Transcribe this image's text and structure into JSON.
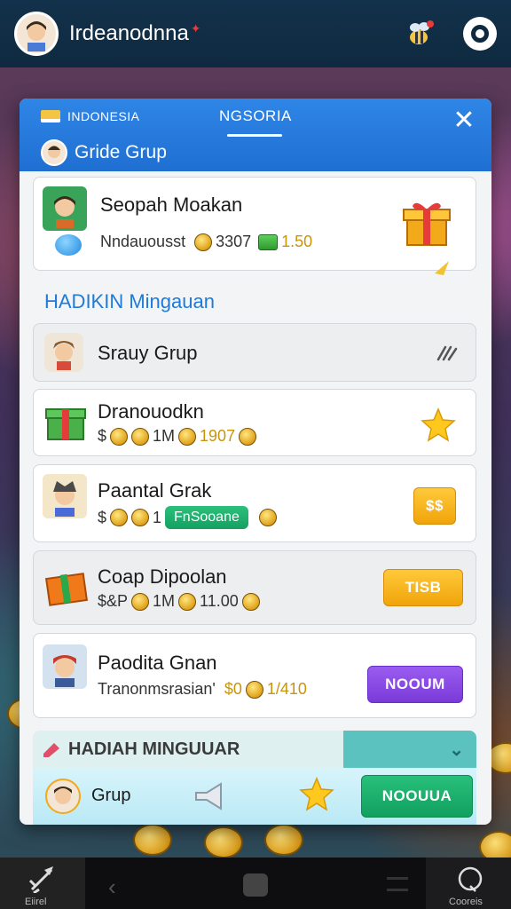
{
  "header": {
    "title": "Irdeanodnna",
    "avatar_icon": "avatar-icon",
    "bee_icon": "bee-icon",
    "settings_icon": "settings-icon"
  },
  "modal": {
    "region_label": "INDONESIA",
    "tab_label": "NGSORIA",
    "close_label": "✕",
    "group_title": "Gride Grup"
  },
  "top_card": {
    "name": "Seopah Moakan",
    "sub_label": "Nndauousst",
    "value_a": "3307",
    "value_b": "1.50"
  },
  "section_title": "HADIKIN Mingauan",
  "rows": [
    {
      "name": "Srauy Grup"
    },
    {
      "name": "Dranouodkn",
      "sub_a": "$",
      "sub_b": "1M",
      "sub_c": "1907"
    },
    {
      "name": "Paantal Grak",
      "sub_a": "$",
      "sub_b": "1",
      "pill": "FnSooane",
      "button": "$$"
    },
    {
      "name": "Coap Dipoolan",
      "sub_a": "$&P",
      "sub_b": "1M",
      "sub_c": "11.00",
      "button": "TISB"
    },
    {
      "name": "Paodita Gnan",
      "sub_label": "Tranonmsrasian'",
      "sub_a": "$0",
      "sub_c": "1/410",
      "button": "NOOUM"
    }
  ],
  "footer": {
    "title": "HADIAH MINGUUAR",
    "row_label": "Grup",
    "button": "NOOUUA"
  },
  "navbar": {
    "left_label": "Eiirel",
    "right_label": "Cooreis"
  },
  "colors": {
    "header_bg": "#12314a",
    "modal_head": "#2f86e6",
    "accent_blue": "#1f7ad8",
    "yellow": "#f0a40a",
    "purple": "#7a3ad8",
    "green": "#12a060"
  }
}
